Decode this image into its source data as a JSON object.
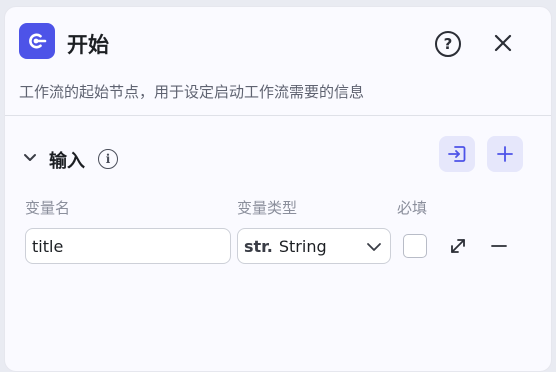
{
  "header": {
    "title": "开始",
    "description": "工作流的起始节点，用于设定启动工作流需要的信息",
    "help_glyph": "?",
    "node_icon": "start-node-icon",
    "accent_color": "#4d53e8"
  },
  "input_section": {
    "title": "输入",
    "info_glyph": "i",
    "columns": {
      "name": "变量名",
      "type": "变量类型",
      "required": "必填"
    },
    "rows": [
      {
        "name": "title",
        "type_prefix": "str.",
        "type": "String",
        "required": false
      }
    ]
  }
}
